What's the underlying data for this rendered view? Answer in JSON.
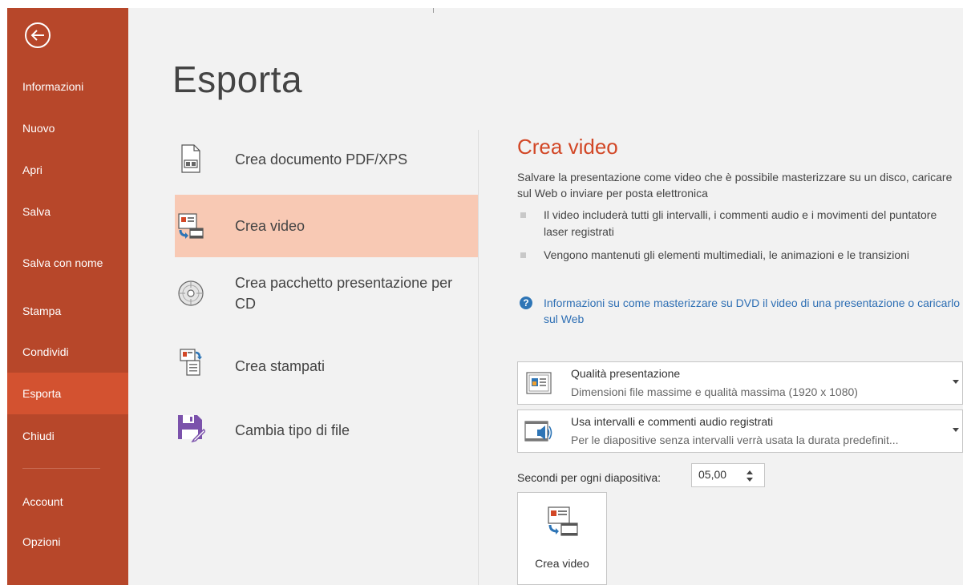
{
  "sidebar": {
    "back_label": "",
    "items": [
      {
        "label": "Informazioni"
      },
      {
        "label": "Nuovo"
      },
      {
        "label": "Apri"
      },
      {
        "label": "Salva"
      },
      {
        "label": "Salva con nome"
      },
      {
        "label": "Stampa"
      },
      {
        "label": "Condividi"
      },
      {
        "label": "Esporta",
        "active": true
      },
      {
        "label": "Chiudi"
      },
      {
        "label": "Account"
      },
      {
        "label": "Opzioni"
      }
    ]
  },
  "main": {
    "title": "Esporta",
    "options": [
      {
        "label": "Crea documento PDF/XPS",
        "icon": "pdf-document-icon"
      },
      {
        "label": "Crea video",
        "icon": "video-icon",
        "selected": true
      },
      {
        "label": "Crea pacchetto presentazione per CD",
        "icon": "cd-icon"
      },
      {
        "label": "Crea stampati",
        "icon": "handouts-icon"
      },
      {
        "label": "Cambia tipo di file",
        "icon": "save-file-icon"
      }
    ]
  },
  "detail": {
    "title": "Crea video",
    "description": "Salvare la presentazione come video che è possibile masterizzare su un disco, caricare sul Web o inviare per posta elettronica",
    "bullets": [
      "Il video includerà tutti gli intervalli, i commenti audio e i movimenti del puntatore laser registrati",
      "Vengono mantenuti gli elementi multimediali, le animazioni e le transizioni"
    ],
    "help_link": "Informazioni su come masterizzare su DVD il video di una presentazione o caricarlo sul Web",
    "quality": {
      "title": "Qualità presentazione",
      "subtitle": "Dimensioni file massime e qualità massima (1920 x 1080)"
    },
    "timing": {
      "title": "Usa intervalli e commenti audio registrati",
      "subtitle": "Per le diapositive senza intervalli verrà usata la durata predefinit..."
    },
    "seconds_label": "Secondi per ogni diapositiva:",
    "seconds_value": "05,00",
    "create_button": "Crea video"
  },
  "colors": {
    "sidebar_bg": "#b7472a",
    "sidebar_active": "#d35230",
    "selected_option": "#f8c9b4",
    "accent_title": "#d24726",
    "link": "#2e6fb4"
  }
}
